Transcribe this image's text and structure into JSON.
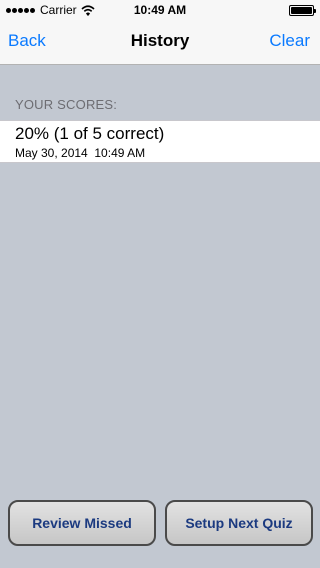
{
  "status_bar": {
    "carrier": "Carrier",
    "time": "10:49 AM"
  },
  "nav": {
    "back_label": "Back",
    "title": "History",
    "clear_label": "Clear"
  },
  "scores": {
    "section_header": "YOUR SCORES:",
    "items": [
      {
        "title": "20% (1 of 5 correct)",
        "date": "May 30, 2014  10:49 AM"
      }
    ]
  },
  "buttons": {
    "review_missed": "Review Missed",
    "setup_next_quiz": "Setup Next Quiz"
  },
  "colors": {
    "accent": "#0a7aff",
    "background": "#c2c8d1",
    "button_text": "#1b3a80"
  }
}
